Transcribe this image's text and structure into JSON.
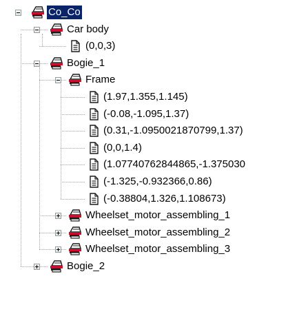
{
  "tree": {
    "nodes": [
      {
        "label": "Co_Co",
        "level": 0,
        "type": "assembly",
        "expander": "minus",
        "selected": true
      },
      {
        "label": "Car body",
        "level": 1,
        "type": "assembly",
        "expander": "minus"
      },
      {
        "label": "(0,0,3)",
        "level": 2,
        "type": "document",
        "expander": null
      },
      {
        "label": "Bogie_1",
        "level": 1,
        "type": "assembly",
        "expander": "minus"
      },
      {
        "label": "Frame",
        "level": 2,
        "type": "assembly",
        "expander": "minus"
      },
      {
        "label": "(1.97,1.355,1.145)",
        "level": 3,
        "type": "document",
        "expander": null
      },
      {
        "label": "(-0.08,-1.095,1.37)",
        "level": 3,
        "type": "document",
        "expander": null
      },
      {
        "label": "(0.31,-1.0950021870799,1.37)",
        "level": 3,
        "type": "document",
        "expander": null
      },
      {
        "label": "(0,0,1.4)",
        "level": 3,
        "type": "document",
        "expander": null
      },
      {
        "label": "(1.07740762844865,-1.375030",
        "level": 3,
        "type": "document",
        "expander": null
      },
      {
        "label": "(-1.325,-0.932366,0.86)",
        "level": 3,
        "type": "document",
        "expander": null
      },
      {
        "label": "(-0.38804,1.326,1.108673)",
        "level": 3,
        "type": "document",
        "expander": null
      },
      {
        "label": "Wheelset_motor_assembling_1",
        "level": 2,
        "type": "assembly",
        "expander": "plus"
      },
      {
        "label": "Wheelset_motor_assembling_2",
        "level": 2,
        "type": "assembly",
        "expander": "plus"
      },
      {
        "label": "Wheelset_motor_assembling_3",
        "level": 2,
        "type": "assembly",
        "expander": "plus"
      },
      {
        "label": "Bogie_2",
        "level": 1,
        "type": "assembly",
        "expander": "plus"
      }
    ]
  }
}
